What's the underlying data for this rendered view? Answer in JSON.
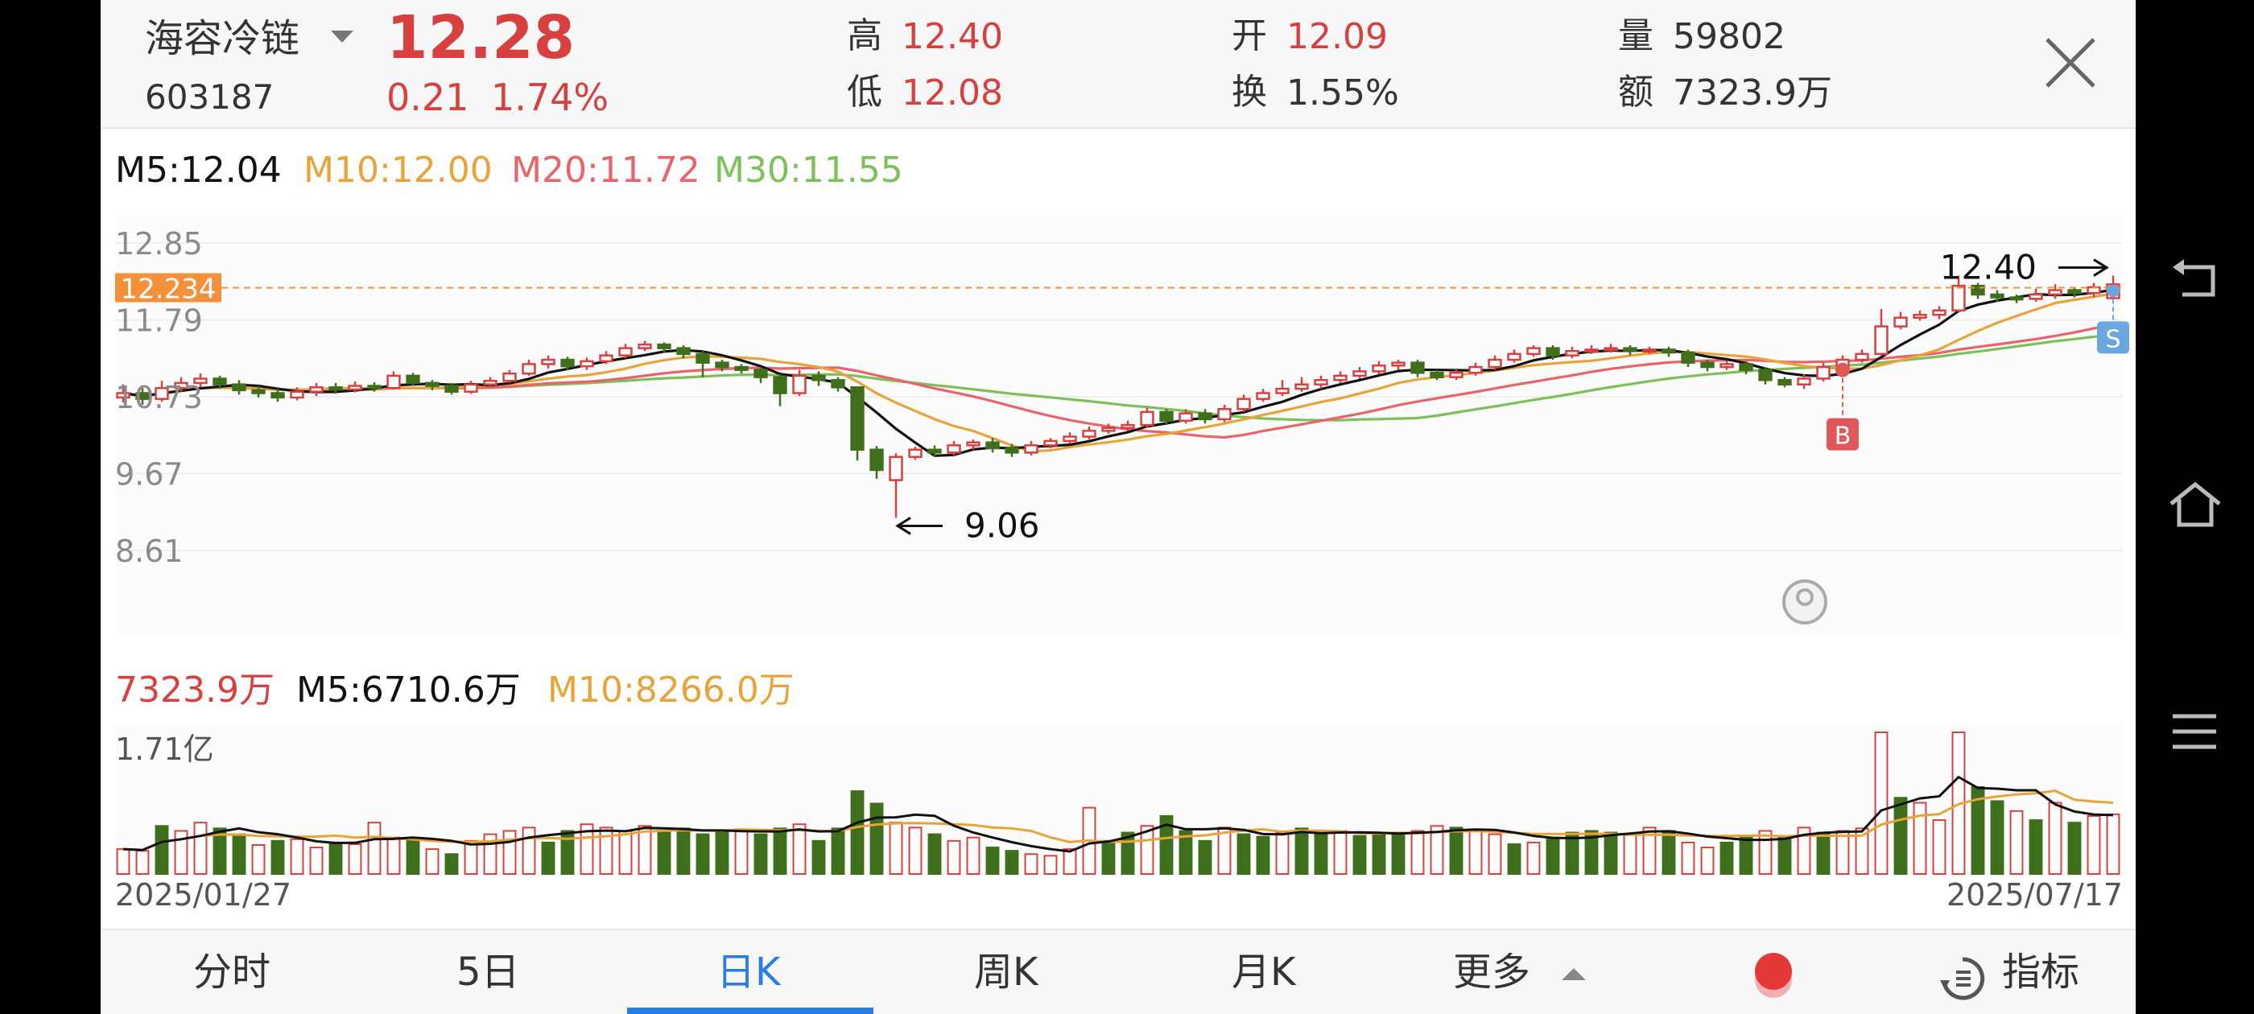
{
  "stock": {
    "name": "海容冷链",
    "code": "603187",
    "price": "12.28",
    "change": "0.21",
    "change_pct": "1.74%"
  },
  "quote": [
    {
      "label": "高",
      "value": "12.40",
      "color": "red"
    },
    {
      "label": "低",
      "value": "12.08",
      "color": "red"
    },
    {
      "label": "开",
      "value": "12.09",
      "color": "red"
    },
    {
      "label": "换",
      "value": "1.55%",
      "color": "dark"
    },
    {
      "label": "量",
      "value": "59802",
      "color": "dark"
    },
    {
      "label": "额",
      "value": "7323.9万",
      "color": "dark"
    }
  ],
  "ma_legend": {
    "m5": "M5:12.04",
    "m10": "M10:12.00",
    "m20": "M20:11.72",
    "m30": "M30:11.55"
  },
  "vol_legend": {
    "vol": "7323.9万",
    "m5": "M5:6710.6万",
    "m10": "M10:8266.0万"
  },
  "tabs": [
    {
      "label": "分时"
    },
    {
      "label": "5日"
    },
    {
      "label": "日K"
    },
    {
      "label": "周K"
    },
    {
      "label": "月K"
    },
    {
      "label": "更多"
    },
    {
      "label": "指标"
    }
  ],
  "colors": {
    "up": "#d8403f",
    "down": "#3f6e1c",
    "ma5": "#111111",
    "ma10": "#e8a33a",
    "ma20": "#e8636a",
    "ma30": "#7cc05a",
    "accent": "#2a7de1",
    "cursor": "#f5903a"
  },
  "chart_data": {
    "type": "candlestick",
    "y_ticks": [
      "12.85",
      "11.79",
      "10.73",
      "9.67",
      "8.61"
    ],
    "ylim": [
      8.61,
      12.85
    ],
    "cursor_price": "12.234",
    "high_mark": "12.40",
    "low_mark": "9.06",
    "markers": {
      "buy": "B",
      "sell": "S"
    },
    "x_labels": [
      "2025/01/27",
      "2025/07/17"
    ],
    "vol_ylabel": "1.71亿",
    "vol_max": 1.71,
    "candles": [
      [
        10.72,
        10.78,
        10.65,
        10.9
      ],
      [
        10.78,
        10.7,
        10.62,
        10.85
      ],
      [
        10.7,
        10.85,
        10.66,
        10.95
      ],
      [
        10.85,
        10.92,
        10.8,
        11.0
      ],
      [
        10.92,
        10.98,
        10.86,
        11.05
      ],
      [
        10.98,
        10.9,
        10.84,
        11.02
      ],
      [
        10.9,
        10.82,
        10.76,
        10.96
      ],
      [
        10.82,
        10.78,
        10.72,
        10.88
      ],
      [
        10.78,
        10.72,
        10.66,
        10.84
      ],
      [
        10.72,
        10.8,
        10.68,
        10.86
      ],
      [
        10.8,
        10.86,
        10.74,
        10.92
      ],
      [
        10.86,
        10.83,
        10.77,
        10.92
      ],
      [
        10.83,
        10.88,
        10.79,
        10.94
      ],
      [
        10.88,
        10.85,
        10.8,
        10.93
      ],
      [
        10.85,
        11.02,
        10.83,
        11.08
      ],
      [
        11.02,
        10.92,
        10.88,
        11.06
      ],
      [
        10.92,
        10.88,
        10.82,
        10.96
      ],
      [
        10.88,
        10.8,
        10.76,
        10.92
      ],
      [
        10.8,
        10.9,
        10.77,
        10.95
      ],
      [
        10.9,
        10.95,
        10.86,
        11.0
      ],
      [
        10.95,
        11.05,
        10.92,
        11.1
      ],
      [
        11.05,
        11.18,
        11.02,
        11.24
      ],
      [
        11.18,
        11.24,
        11.12,
        11.3
      ],
      [
        11.24,
        11.15,
        11.1,
        11.28
      ],
      [
        11.15,
        11.22,
        11.1,
        11.27
      ],
      [
        11.22,
        11.3,
        11.18,
        11.36
      ],
      [
        11.3,
        11.4,
        11.26,
        11.46
      ],
      [
        11.4,
        11.45,
        11.36,
        11.5
      ],
      [
        11.45,
        11.4,
        11.34,
        11.48
      ],
      [
        11.4,
        11.32,
        11.26,
        11.44
      ],
      [
        11.32,
        11.2,
        11.0,
        11.36
      ],
      [
        11.2,
        11.14,
        11.08,
        11.24
      ],
      [
        11.14,
        11.1,
        11.05,
        11.18
      ],
      [
        11.1,
        11.0,
        10.92,
        11.14
      ],
      [
        11.0,
        10.78,
        10.6,
        11.04
      ],
      [
        10.78,
        11.02,
        10.74,
        11.1
      ],
      [
        11.02,
        10.96,
        10.88,
        11.08
      ],
      [
        10.96,
        10.86,
        10.8,
        11.0
      ],
      [
        10.86,
        10.0,
        9.85,
        10.22
      ],
      [
        10.0,
        9.72,
        9.6,
        10.05
      ],
      [
        9.58,
        9.9,
        9.06,
        9.95
      ],
      [
        9.9,
        10.0,
        9.86,
        10.04
      ],
      [
        10.0,
        9.96,
        9.9,
        10.06
      ],
      [
        9.96,
        10.06,
        9.92,
        10.12
      ],
      [
        10.06,
        10.1,
        10.0,
        10.14
      ],
      [
        10.1,
        10.02,
        9.96,
        10.16
      ],
      [
        10.02,
        9.96,
        9.9,
        10.08
      ],
      [
        9.96,
        10.06,
        9.92,
        10.12
      ],
      [
        10.06,
        10.12,
        10.02,
        10.16
      ],
      [
        10.12,
        10.18,
        10.08,
        10.24
      ],
      [
        10.18,
        10.26,
        10.14,
        10.32
      ],
      [
        10.26,
        10.3,
        10.22,
        10.36
      ],
      [
        10.3,
        10.34,
        10.26,
        10.4
      ],
      [
        10.34,
        10.52,
        10.3,
        10.58
      ],
      [
        10.52,
        10.4,
        10.34,
        10.56
      ],
      [
        10.4,
        10.5,
        10.36,
        10.56
      ],
      [
        10.5,
        10.42,
        10.36,
        10.56
      ],
      [
        10.42,
        10.56,
        10.38,
        10.62
      ],
      [
        10.56,
        10.7,
        10.52,
        10.76
      ],
      [
        10.7,
        10.78,
        10.66,
        10.84
      ],
      [
        10.78,
        10.84,
        10.74,
        10.96
      ],
      [
        10.84,
        10.9,
        10.8,
        11.0
      ],
      [
        10.9,
        10.96,
        10.84,
        11.02
      ],
      [
        10.96,
        11.02,
        10.92,
        11.08
      ],
      [
        11.02,
        11.08,
        10.98,
        11.14
      ],
      [
        11.08,
        11.16,
        11.04,
        11.22
      ],
      [
        11.16,
        11.2,
        11.1,
        11.24
      ],
      [
        11.2,
        11.06,
        11.0,
        11.24
      ],
      [
        11.06,
        11.0,
        10.96,
        11.1
      ],
      [
        11.0,
        11.06,
        10.96,
        11.12
      ],
      [
        11.06,
        11.14,
        11.02,
        11.2
      ],
      [
        11.14,
        11.24,
        11.1,
        11.3
      ],
      [
        11.24,
        11.32,
        11.2,
        11.38
      ],
      [
        11.32,
        11.4,
        11.28,
        11.44
      ],
      [
        11.4,
        11.3,
        11.24,
        11.44
      ],
      [
        11.3,
        11.36,
        11.26,
        11.42
      ],
      [
        11.36,
        11.38,
        11.32,
        11.44
      ],
      [
        11.38,
        11.4,
        11.34,
        11.46
      ],
      [
        11.4,
        11.36,
        11.3,
        11.44
      ],
      [
        11.36,
        11.38,
        11.32,
        11.42
      ],
      [
        11.38,
        11.34,
        11.28,
        11.42
      ],
      [
        11.34,
        11.2,
        11.14,
        11.38
      ],
      [
        11.2,
        11.14,
        11.08,
        11.24
      ],
      [
        11.14,
        11.18,
        11.1,
        11.22
      ],
      [
        11.18,
        11.1,
        11.04,
        11.22
      ],
      [
        11.1,
        10.96,
        10.9,
        11.14
      ],
      [
        10.96,
        10.9,
        10.86,
        11.0
      ],
      [
        10.9,
        10.98,
        10.84,
        11.04
      ],
      [
        10.98,
        11.14,
        10.94,
        11.2
      ],
      [
        11.14,
        11.24,
        11.1,
        11.3
      ],
      [
        11.24,
        11.32,
        11.2,
        11.38
      ],
      [
        11.32,
        11.7,
        11.3,
        11.94
      ],
      [
        11.7,
        11.82,
        11.66,
        11.9
      ],
      [
        11.82,
        11.86,
        11.78,
        11.92
      ],
      [
        11.86,
        11.92,
        11.8,
        11.98
      ],
      [
        11.92,
        12.26,
        11.9,
        12.4
      ],
      [
        12.26,
        12.14,
        12.08,
        12.3
      ],
      [
        12.14,
        12.1,
        12.04,
        12.2
      ],
      [
        12.1,
        12.08,
        12.02,
        12.14
      ],
      [
        12.08,
        12.14,
        12.04,
        12.22
      ],
      [
        12.14,
        12.2,
        12.08,
        12.28
      ],
      [
        12.2,
        12.16,
        12.1,
        12.24
      ],
      [
        12.16,
        12.24,
        12.1,
        12.3
      ],
      [
        12.09,
        12.28,
        12.08,
        12.4
      ]
    ],
    "volumes": [
      [
        0.3,
        1
      ],
      [
        0.28,
        1
      ],
      [
        0.58,
        0
      ],
      [
        0.52,
        1
      ],
      [
        0.62,
        1
      ],
      [
        0.55,
        0
      ],
      [
        0.48,
        0
      ],
      [
        0.35,
        1
      ],
      [
        0.4,
        0
      ],
      [
        0.42,
        1
      ],
      [
        0.32,
        1
      ],
      [
        0.38,
        0
      ],
      [
        0.36,
        1
      ],
      [
        0.62,
        1
      ],
      [
        0.44,
        1
      ],
      [
        0.4,
        0
      ],
      [
        0.3,
        1
      ],
      [
        0.24,
        0
      ],
      [
        0.4,
        1
      ],
      [
        0.48,
        1
      ],
      [
        0.52,
        1
      ],
      [
        0.56,
        1
      ],
      [
        0.38,
        0
      ],
      [
        0.52,
        0
      ],
      [
        0.6,
        1
      ],
      [
        0.56,
        1
      ],
      [
        0.52,
        1
      ],
      [
        0.58,
        1
      ],
      [
        0.5,
        0
      ],
      [
        0.55,
        0
      ],
      [
        0.48,
        0
      ],
      [
        0.52,
        0
      ],
      [
        0.54,
        1
      ],
      [
        0.48,
        0
      ],
      [
        0.55,
        0
      ],
      [
        0.6,
        1
      ],
      [
        0.4,
        0
      ],
      [
        0.55,
        0
      ],
      [
        1.0,
        0
      ],
      [
        0.85,
        0
      ],
      [
        0.62,
        1
      ],
      [
        0.56,
        1
      ],
      [
        0.48,
        0
      ],
      [
        0.4,
        1
      ],
      [
        0.44,
        1
      ],
      [
        0.32,
        0
      ],
      [
        0.28,
        0
      ],
      [
        0.24,
        1
      ],
      [
        0.22,
        1
      ],
      [
        0.3,
        1
      ],
      [
        0.8,
        1
      ],
      [
        0.4,
        0
      ],
      [
        0.5,
        0
      ],
      [
        0.58,
        1
      ],
      [
        0.7,
        0
      ],
      [
        0.52,
        0
      ],
      [
        0.4,
        0
      ],
      [
        0.56,
        1
      ],
      [
        0.48,
        0
      ],
      [
        0.45,
        0
      ],
      [
        0.5,
        1
      ],
      [
        0.55,
        0
      ],
      [
        0.48,
        0
      ],
      [
        0.52,
        1
      ],
      [
        0.46,
        0
      ],
      [
        0.48,
        0
      ],
      [
        0.5,
        0
      ],
      [
        0.52,
        1
      ],
      [
        0.58,
        1
      ],
      [
        0.56,
        0
      ],
      [
        0.52,
        1
      ],
      [
        0.48,
        1
      ],
      [
        0.36,
        0
      ],
      [
        0.38,
        1
      ],
      [
        0.44,
        0
      ],
      [
        0.5,
        0
      ],
      [
        0.52,
        0
      ],
      [
        0.5,
        0
      ],
      [
        0.48,
        1
      ],
      [
        0.56,
        1
      ],
      [
        0.52,
        0
      ],
      [
        0.38,
        1
      ],
      [
        0.32,
        1
      ],
      [
        0.38,
        0
      ],
      [
        0.46,
        0
      ],
      [
        0.52,
        1
      ],
      [
        0.44,
        0
      ],
      [
        0.56,
        1
      ],
      [
        0.5,
        0
      ],
      [
        0.52,
        1
      ],
      [
        0.55,
        1
      ],
      [
        1.71,
        1
      ],
      [
        0.92,
        0
      ],
      [
        0.86,
        1
      ],
      [
        0.65,
        1
      ],
      [
        1.71,
        1
      ],
      [
        1.05,
        0
      ],
      [
        0.88,
        0
      ],
      [
        0.76,
        1
      ],
      [
        0.65,
        0
      ],
      [
        0.86,
        1
      ],
      [
        0.62,
        0
      ],
      [
        0.7,
        1
      ],
      [
        0.72,
        1
      ]
    ]
  }
}
